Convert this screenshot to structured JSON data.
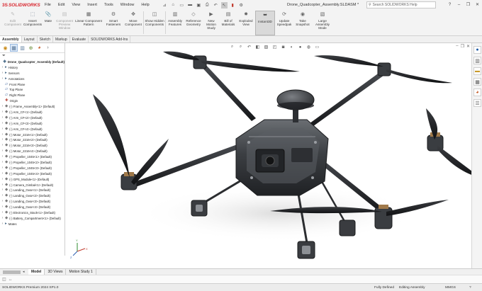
{
  "app": {
    "logo_prefix": "3S",
    "logo_text": "SOLIDWORKS",
    "document_title": "Drone_Quadcopter_Assembly.SLDASM *",
    "search_placeholder": "Search SOLIDWORKS Help"
  },
  "menu": [
    "File",
    "Edit",
    "View",
    "Insert",
    "Tools",
    "Window",
    "Help"
  ],
  "ribbon": [
    {
      "label": "Edit Component",
      "icon": "edit-component-icon",
      "dim": true
    },
    {
      "label": "Insert Components",
      "icon": "insert-components-icon",
      "dim": false
    },
    {
      "label": "Mate",
      "icon": "mate-icon",
      "dim": false
    },
    {
      "label": "Component Preview Window",
      "icon": "preview-window-icon",
      "dim": true
    },
    {
      "label": "Linear Component Pattern",
      "icon": "linear-pattern-icon",
      "dim": false
    },
    {
      "label": "Smart Fasteners",
      "icon": "smart-fasteners-icon",
      "dim": false
    },
    {
      "label": "Move Component",
      "icon": "move-component-icon",
      "dim": false
    },
    {
      "label": "Show Hidden Components",
      "icon": "show-hidden-icon",
      "dim": false
    },
    {
      "label": "Assembly Features",
      "icon": "assembly-features-icon",
      "dim": false
    },
    {
      "label": "Reference Geometry",
      "icon": "reference-geometry-icon",
      "dim": false
    },
    {
      "label": "New Motion Study",
      "icon": "motion-study-icon",
      "dim": false
    },
    {
      "label": "Bill of Materials",
      "icon": "bom-icon",
      "dim": false
    },
    {
      "label": "Exploded View",
      "icon": "exploded-view-icon",
      "dim": false
    },
    {
      "label": "Instant3D",
      "icon": "instant3d-icon",
      "dim": false,
      "active": true
    },
    {
      "label": "Update Speedpak",
      "icon": "speedpak-icon",
      "dim": false
    },
    {
      "label": "Take Snapshot",
      "icon": "snapshot-icon",
      "dim": false
    },
    {
      "label": "Large Assembly Mode",
      "icon": "large-assembly-icon",
      "dim": false
    }
  ],
  "tabs": [
    "Assembly",
    "Layout",
    "Sketch",
    "Markup",
    "Evaluate",
    "SOLIDWORKS Add-Ins"
  ],
  "tabs_active": "Assembly",
  "tree": [
    {
      "label": "Drone_Quadcopter_Assembly  (Default)",
      "kind": "root"
    },
    {
      "label": "History",
      "kind": "folder"
    },
    {
      "label": "Sensors",
      "kind": "folder"
    },
    {
      "label": "Annotations",
      "kind": "folder"
    },
    {
      "label": "Front Plane",
      "kind": "plane"
    },
    {
      "label": "Top Plane",
      "kind": "plane"
    },
    {
      "label": "Right Plane",
      "kind": "plane"
    },
    {
      "label": "Origin",
      "kind": "origin"
    },
    {
      "label": "(-) Frame_Assembly<1> (Default)",
      "kind": "comp"
    },
    {
      "label": "(-) Arm_CF<1> (Default)",
      "kind": "comp"
    },
    {
      "label": "(-) Arm_CF<2> (Default)",
      "kind": "comp"
    },
    {
      "label": "(-) Arm_CF<3> (Default)",
      "kind": "comp"
    },
    {
      "label": "(-) Arm_CF<4> (Default)",
      "kind": "comp"
    },
    {
      "label": "(-) Motor_2216<1> (Default)",
      "kind": "comp"
    },
    {
      "label": "(-) Motor_2216<2> (Default)",
      "kind": "comp"
    },
    {
      "label": "(-) Motor_2216<3> (Default)",
      "kind": "comp"
    },
    {
      "label": "(-) Motor_2216<4> (Default)",
      "kind": "comp"
    },
    {
      "label": "(-) Propeller_1045<1> (Default)",
      "kind": "comp"
    },
    {
      "label": "(-) Propeller_1045<2> (Default)",
      "kind": "comp"
    },
    {
      "label": "(-) Propeller_1045<3> (Default)",
      "kind": "comp"
    },
    {
      "label": "(-) Propeller_1045<4> (Default)",
      "kind": "comp"
    },
    {
      "label": "(-) GPS_Module<1> (Default)",
      "kind": "comp"
    },
    {
      "label": "(-) Camera_Gimbal<1> (Default)",
      "kind": "comp"
    },
    {
      "label": "(-) Landing_Gear<1> (Default)",
      "kind": "comp"
    },
    {
      "label": "(-) Landing_Gear<2> (Default)",
      "kind": "comp"
    },
    {
      "label": "(-) Landing_Gear<3> (Default)",
      "kind": "comp"
    },
    {
      "label": "(-) Landing_Gear<4> (Default)",
      "kind": "comp"
    },
    {
      "label": "(-) Electronics_Stack<1> (Default)",
      "kind": "comp"
    },
    {
      "label": "(-) Battery_Compartment<1> (Default)",
      "kind": "comp"
    },
    {
      "label": "Mates",
      "kind": "folder"
    }
  ],
  "bottom_tabs": [
    "Model",
    "3D Views",
    "Motion Study 1"
  ],
  "bottom_active": "Model",
  "status": {
    "product": "SOLIDWORKS Premium 2024 SP1.0",
    "defined": "Fully Defined",
    "mode": "Editing Assembly",
    "units": "MMGS"
  },
  "colors": {
    "brand": "#d8262e",
    "chrome": "#f3f3f3",
    "selection": "#dbe8f7"
  }
}
